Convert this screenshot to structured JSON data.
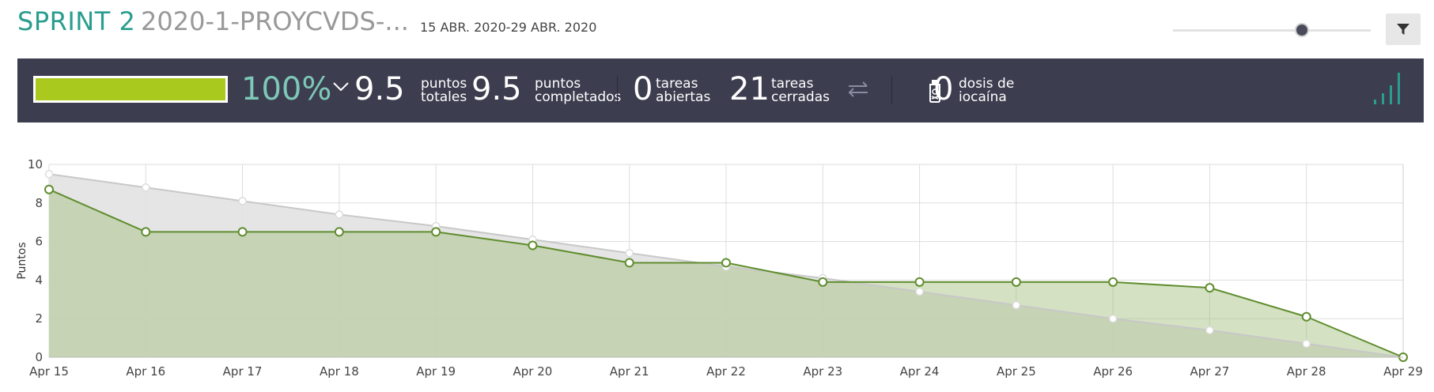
{
  "header": {
    "sprint_label": "SPRINT 2",
    "project_label": "2020-1-PROYCVDS-...",
    "dates": "15 ABR. 2020-29 ABR. 2020",
    "filter_icon": "funnel-icon"
  },
  "zoom_slider": {
    "value": 0.65
  },
  "summary": {
    "progress_fraction": 1.0,
    "progress_color": "#a9c91f",
    "percent": "100%",
    "total_points": {
      "value": "9.5",
      "label1": "puntos",
      "label2": "totales"
    },
    "completed_points": {
      "value": "9.5",
      "label1": "puntos",
      "label2": "completados"
    },
    "open_tasks": {
      "value": "0",
      "label1": "tareas",
      "label2": "abiertas"
    },
    "closed_tasks": {
      "value": "21",
      "label1": "tareas",
      "label2": "cerradas"
    },
    "iocaine": {
      "value": "0",
      "label1": "dosis de",
      "label2": "iocaína"
    }
  },
  "chart_data": {
    "type": "area",
    "ylabel": "Puntos",
    "xlabel": "",
    "ylim": [
      0,
      10
    ],
    "yticks": [
      0,
      2,
      4,
      6,
      8,
      10
    ],
    "categories": [
      "Apr 15",
      "Apr 16",
      "Apr 17",
      "Apr 18",
      "Apr 19",
      "Apr 20",
      "Apr 21",
      "Apr 22",
      "Apr 23",
      "Apr 24",
      "Apr 25",
      "Apr 26",
      "Apr 27",
      "Apr 28",
      "Apr 29"
    ],
    "grid": true,
    "series": [
      {
        "values": [
          9.5,
          8.8,
          8.1,
          7.4,
          6.8,
          6.1,
          5.4,
          4.7,
          4.1,
          3.4,
          2.7,
          2.0,
          1.4,
          0.7,
          0.0
        ],
        "color": "#c8c8c8"
      },
      {
        "values": [
          8.7,
          6.5,
          6.5,
          6.5,
          6.5,
          5.8,
          4.9,
          4.9,
          3.9,
          3.9,
          3.9,
          3.9,
          3.6,
          2.1,
          0.0
        ],
        "color": "#5f8d2e"
      }
    ]
  }
}
